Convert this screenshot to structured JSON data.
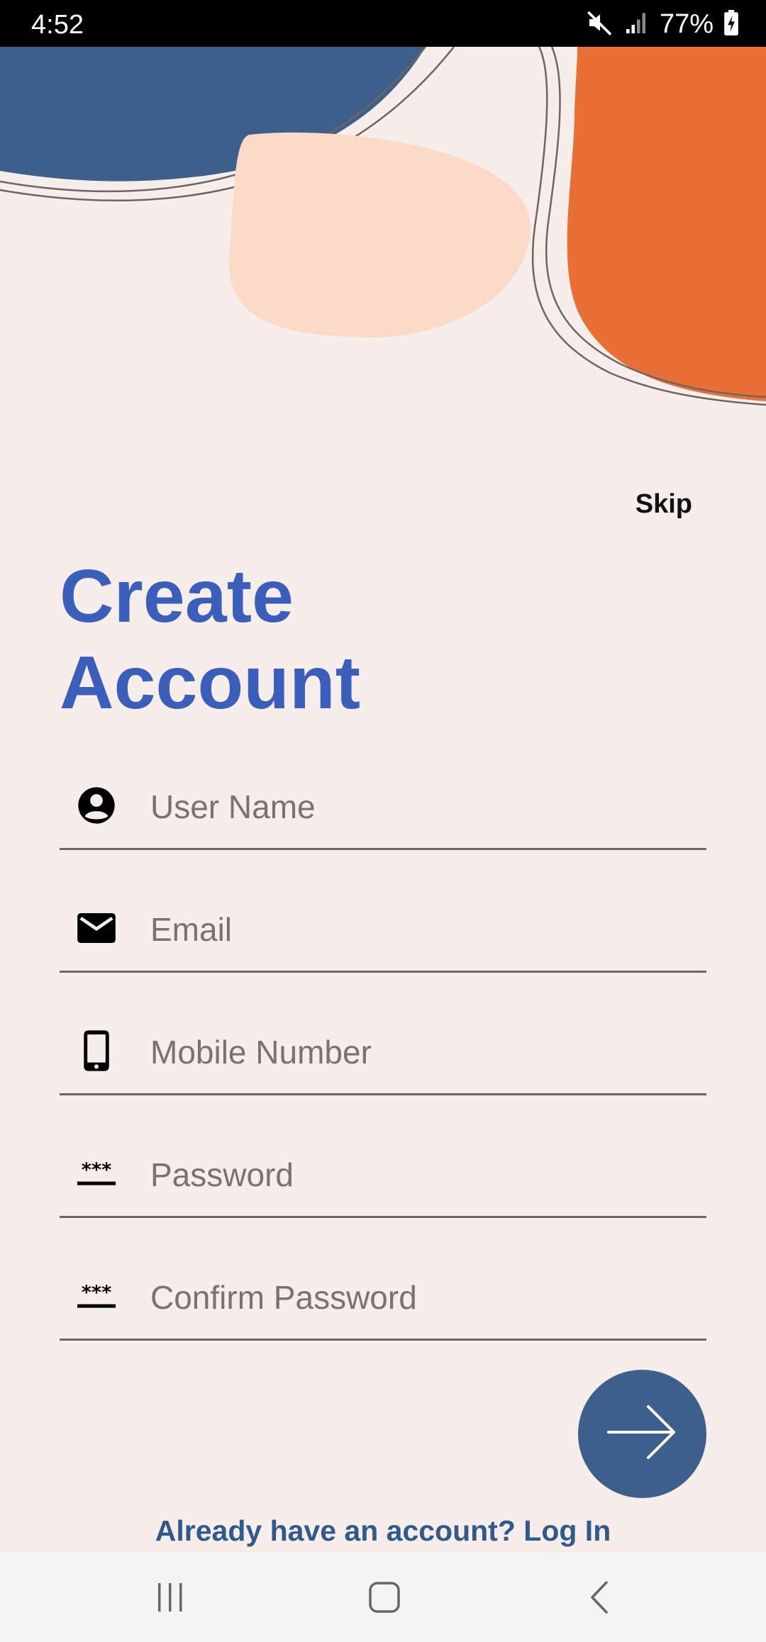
{
  "status_bar": {
    "time": "4:52",
    "battery": "77%",
    "icons": [
      "mute-icon",
      "signal-icon",
      "battery-charging-icon"
    ]
  },
  "skip_label": "Skip",
  "title": {
    "line1": "Create",
    "line2": "Account"
  },
  "fields": {
    "username": {
      "placeholder": "User Name",
      "value": "",
      "icon": "person-icon"
    },
    "email": {
      "placeholder": "Email",
      "value": "",
      "icon": "mail-icon"
    },
    "mobile": {
      "placeholder": "Mobile Number",
      "value": "",
      "icon": "phone-icon"
    },
    "password": {
      "placeholder": "Password",
      "value": "",
      "icon": "password-icon"
    },
    "confirm_password": {
      "placeholder": "Confirm Password",
      "value": "",
      "icon": "password-icon"
    }
  },
  "login_link": "Already have an account? Log In",
  "colors": {
    "background": "#F7EDEA",
    "title": "#3A5EBB",
    "primary_button": "#3C5F8B",
    "link": "#2F5A8A",
    "blob_blue": "#3C5F8B",
    "blob_orange": "#EA6F37",
    "blob_peach": "#FBDBC8"
  }
}
